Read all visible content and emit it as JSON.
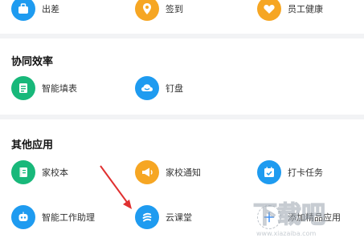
{
  "top_row": [
    {
      "label": "出差",
      "icon": "suitcase-icon",
      "color": "#1e9bf0"
    },
    {
      "label": "签到",
      "icon": "location-pin-icon",
      "color": "#f6a623"
    },
    {
      "label": "员工健康",
      "icon": "heart-icon",
      "color": "#f6a623"
    }
  ],
  "sections": [
    {
      "title": "协同效率",
      "apps": [
        {
          "label": "智能填表",
          "icon": "form-icon",
          "color": "#18b87a"
        },
        {
          "label": "钉盘",
          "icon": "cloud-icon",
          "color": "#1e9bf0"
        }
      ]
    },
    {
      "title": "其他应用",
      "apps": [
        {
          "label": "家校本",
          "icon": "notebook-icon",
          "color": "#18b87a"
        },
        {
          "label": "家校通知",
          "icon": "megaphone-icon",
          "color": "#f6a623"
        },
        {
          "label": "打卡任务",
          "icon": "calendar-check-icon",
          "color": "#1e9bf0"
        },
        {
          "label": "智能工作助理",
          "icon": "robot-icon",
          "color": "#1e9bf0"
        },
        {
          "label": "云课堂",
          "icon": "classroom-icon",
          "color": "#1e9bf0"
        },
        {
          "label": "添加精品应用",
          "icon": "plus-icon",
          "color": "#3a8ef6"
        }
      ]
    }
  ],
  "annotation": {
    "arrow_color": "#e03030"
  },
  "watermark": {
    "text": "下载吧",
    "url": "www.xiazaiba.com"
  }
}
